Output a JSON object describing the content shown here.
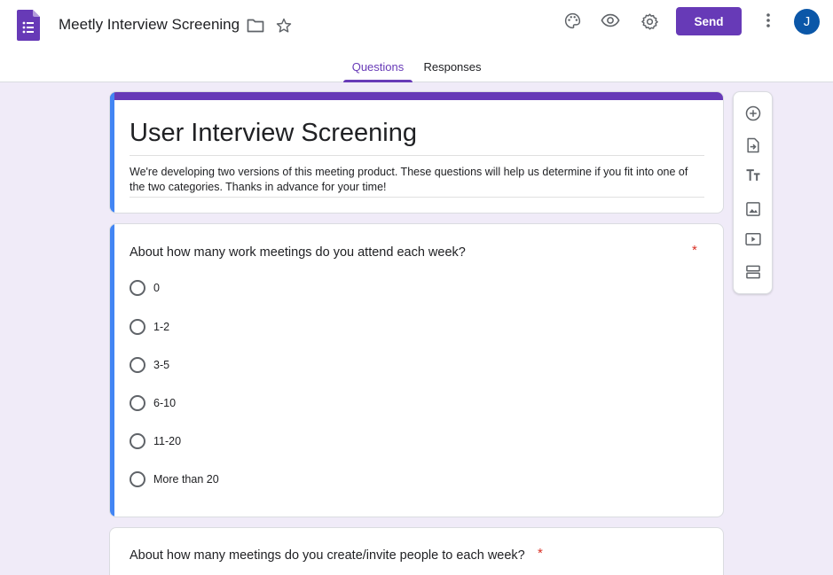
{
  "header": {
    "doc_title": "Meetly Interview Screening",
    "send_label": "Send",
    "avatar_initial": "J",
    "icons": [
      "forms-logo-icon",
      "folder-icon",
      "star-icon",
      "palette-icon",
      "eye-icon",
      "gear-icon",
      "more-vert-icon"
    ]
  },
  "tabs": [
    {
      "label": "Questions",
      "active": true
    },
    {
      "label": "Responses",
      "active": false
    }
  ],
  "form": {
    "title": "User Interview Screening",
    "description": "We're developing two versions of this meeting product. These questions will help us determine if you fit into one of the two categories. Thanks in advance for your time!"
  },
  "questions": [
    {
      "title": "About how many work meetings do you attend each week?",
      "required_marker": "*",
      "options": [
        "0",
        "1-2",
        "3-5",
        "6-10",
        "11-20",
        "More than 20"
      ]
    },
    {
      "title": "About how many meetings do you create/invite people to each week?",
      "required_marker": "*"
    }
  ],
  "toolbar": {
    "tools": [
      "add-question-icon",
      "import-questions-icon",
      "add-title-icon",
      "add-image-icon",
      "add-video-icon",
      "add-section-icon"
    ]
  },
  "colors": {
    "accent": "#673ab7",
    "active_bar": "#4285f4",
    "background": "#f0ebf8",
    "required": "#d93025",
    "avatar": "#0b57a8"
  }
}
